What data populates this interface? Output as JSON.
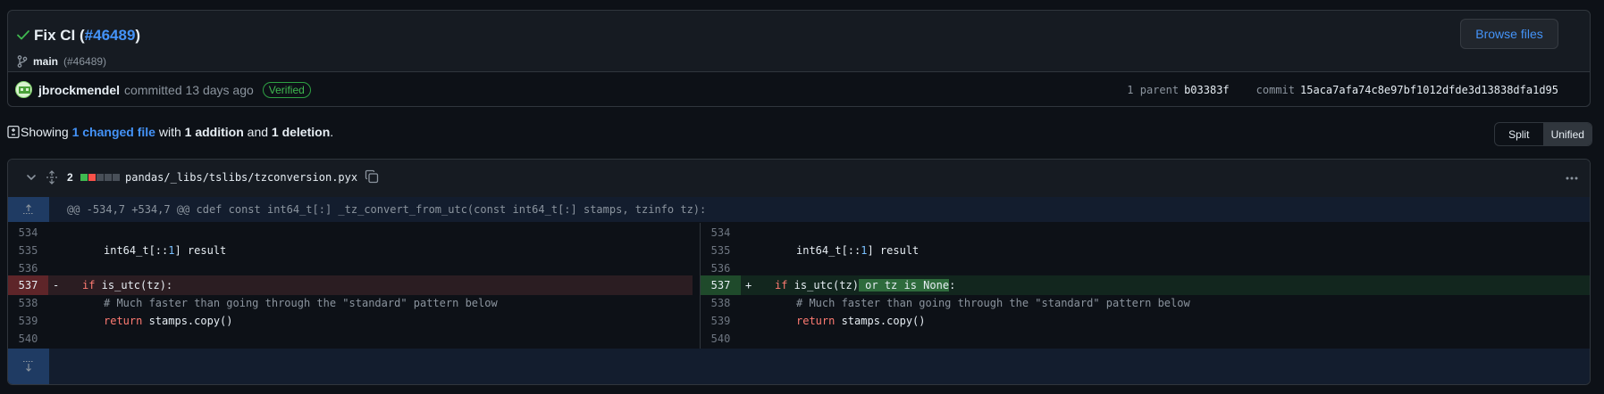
{
  "commit": {
    "title_prefix": "Fix CI (",
    "pr_link": "#46489",
    "title_suffix": ")",
    "branch": "main",
    "branch_pr": "(#46489)",
    "browse_label": "Browse files",
    "author": "jbrockmendel",
    "action": "committed 13 days ago",
    "verified": "Verified",
    "parent_label": "1 parent",
    "parent_sha": "b03383f",
    "commit_label": "commit",
    "commit_sha": "15aca7afa74c8e97bf1012dfde3d13838dfa1d95"
  },
  "summary": {
    "showing": "Showing",
    "changed": "1 changed file",
    "with": "with",
    "additions": "1 addition",
    "and": "and",
    "deletions": "1 deletion",
    "period": "."
  },
  "view_toggle": {
    "split": "Split",
    "unified": "Unified"
  },
  "file": {
    "change_count": "2",
    "path": "pandas/_libs/tslibs/tzconversion.pyx",
    "diffstat": [
      "add",
      "del",
      "neutral",
      "neutral",
      "neutral"
    ]
  },
  "hunk": "@@ -534,7 +534,7 @@ cdef const int64_t[:] _tz_convert_from_utc(const int64_t[:] stamps, tzinfo tz):",
  "lines": {
    "l534": "534",
    "l535": "535",
    "l536": "536",
    "l537": "537",
    "l538": "538",
    "l539": "539",
    "l540": "540",
    "minus": "-",
    "plus": "+",
    "c535_a": "int64_t[::",
    "c535_num": "1",
    "c535_b": "] result",
    "del_kw": "if",
    "del_rest": " is_utc(tz):",
    "add_kw": "if",
    "add_rest": " is_utc(tz)",
    "add_hl": " or tz is None",
    "add_end": ":",
    "c538": "# Much faster than going through the \"standard\" pattern below",
    "c539_kw": "return",
    "c539_rest": " stamps.copy()"
  },
  "colors": {
    "accent": "#4493f8",
    "add": "#3fb950",
    "del": "#f85149"
  }
}
